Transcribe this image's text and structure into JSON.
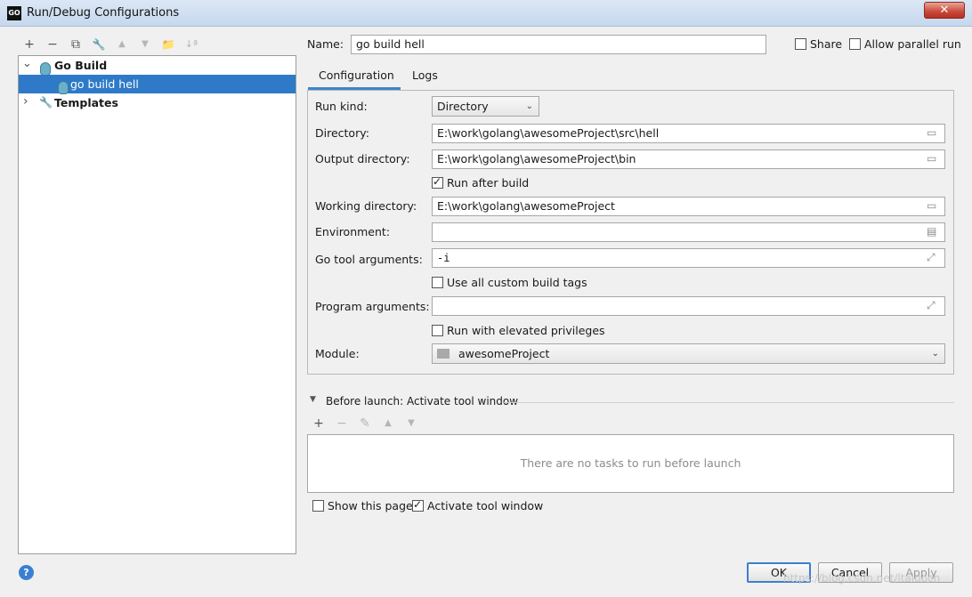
{
  "window": {
    "title": "Run/Debug Configurations",
    "app_icon_text": "GO",
    "close_label": "✕"
  },
  "toolbar": {
    "add": "+",
    "remove": "−",
    "copy": "⧉",
    "edit": "🔧",
    "up": "▲",
    "down": "▼",
    "folder": "📁",
    "sort": "↓ª"
  },
  "tree": {
    "items": [
      {
        "label": "Go Build",
        "arrow": "⌄"
      },
      {
        "label": "go build hell"
      },
      {
        "label": "Templates",
        "arrow": "›"
      }
    ]
  },
  "header": {
    "name_label": "Name:",
    "name_value": "go build hell",
    "share_label": "Share",
    "parallel_label": "Allow parallel run"
  },
  "tabs": [
    {
      "label": "Configuration"
    },
    {
      "label": "Logs"
    }
  ],
  "config": {
    "run_kind_label": "Run kind:",
    "run_kind_value": "Directory",
    "directory_label": "Directory:",
    "directory_value": "E:\\work\\golang\\awesomeProject\\src\\hell",
    "output_dir_label": "Output directory:",
    "output_dir_value": "E:\\work\\golang\\awesomeProject\\bin",
    "run_after_build_label": "Run after build",
    "working_dir_label": "Working directory:",
    "working_dir_value": "E:\\work\\golang\\awesomeProject",
    "environment_label": "Environment:",
    "environment_value": "",
    "go_tool_args_label": "Go tool arguments:",
    "go_tool_args_value": "-i",
    "custom_tags_label": "Use all custom build tags",
    "program_args_label": "Program arguments:",
    "program_args_value": "",
    "elevated_label": "Run with elevated privileges",
    "module_label": "Module:",
    "module_value": "awesomeProject"
  },
  "before_launch": {
    "title": "Before launch: Activate tool window",
    "add": "+",
    "remove": "−",
    "edit": "✎",
    "up": "▲",
    "down": "▼",
    "empty_text": "There are no tasks to run before launch",
    "show_page_label": "Show this page",
    "activate_label": "Activate tool window"
  },
  "buttons": {
    "ok": "OK",
    "cancel": "Cancel",
    "apply": "Apply",
    "help": "?"
  },
  "watermark": "https://blog.csdn.net/ltaiuocn"
}
